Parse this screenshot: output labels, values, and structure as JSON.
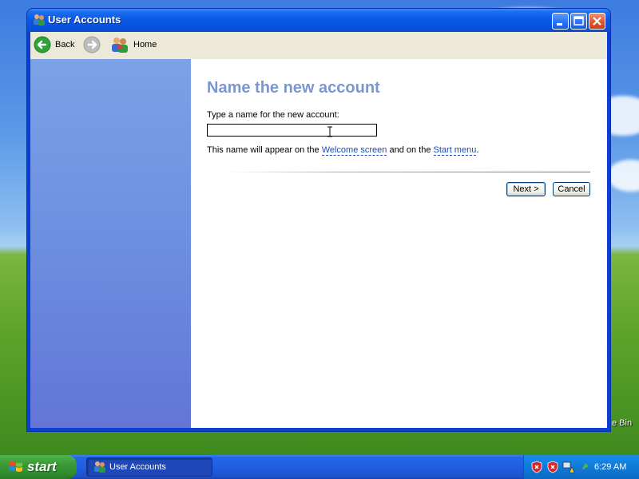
{
  "window": {
    "title": "User Accounts"
  },
  "toolbar": {
    "back_label": "Back",
    "home_label": "Home"
  },
  "main": {
    "heading": "Name the new account",
    "prompt": "Type a name for the new account:",
    "name_value": "",
    "info_prefix": "This name will appear on the ",
    "welcome_link": "Welcome screen",
    "info_middle": " and on the ",
    "start_menu_link": "Start menu",
    "info_suffix": "."
  },
  "buttons": {
    "next": "Next >",
    "cancel": "Cancel"
  },
  "desktop": {
    "recycle_bin_label": "e Bin"
  },
  "taskbar": {
    "start_label": "start",
    "task_label": "User Accounts",
    "clock": "6:29 AM"
  },
  "colors": {
    "titlebar": "#0a58e4",
    "sidebar": "#6c8fe0",
    "heading": "#7b96cf",
    "link": "#1a4bb5",
    "taskbar": "#225ee0",
    "start_button": "#3a9a36"
  }
}
